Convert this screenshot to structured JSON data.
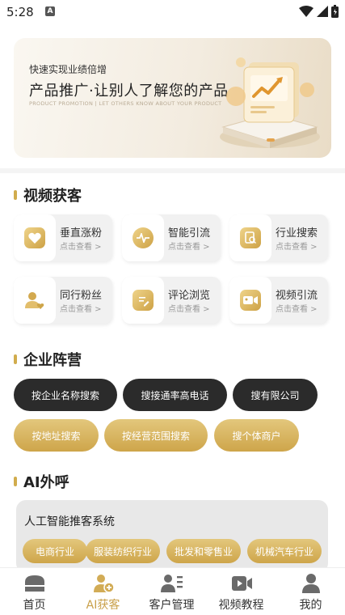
{
  "status_bar": {
    "time": "5:28",
    "notification_icon": "A"
  },
  "banner": {
    "small_text": "快速实现业绩倍增",
    "title": "产品推广·让别人了解您的产品",
    "english": "PRODUCT PROMOTION | LET OTHERS KNOW ABOUT YOUR PRODUCT"
  },
  "video_section": {
    "title": "视频获客",
    "cards": [
      {
        "title": "垂直涨粉",
        "sub": "点击查看 >",
        "icon": "heart-icon"
      },
      {
        "title": "智能引流",
        "sub": "点击查看 >",
        "icon": "pulse-icon"
      },
      {
        "title": "行业搜索",
        "sub": "点击查看 >",
        "icon": "document-search-icon"
      },
      {
        "title": "同行粉丝",
        "sub": "点击查看 >",
        "icon": "user-heart-icon"
      },
      {
        "title": "评论浏览",
        "sub": "点击查看 >",
        "icon": "edit-note-icon"
      },
      {
        "title": "视频引流",
        "sub": "点击查看 >",
        "icon": "video-camera-icon"
      }
    ]
  },
  "enterprise_section": {
    "title": "企业阵营",
    "buttons_dark": [
      "按企业名称搜索",
      "搜接通率高电话",
      "搜有限公司"
    ],
    "buttons_gold": [
      "按地址搜索",
      "按经营范围搜索",
      "搜个体商户"
    ]
  },
  "ai_section": {
    "title": "AI外呼",
    "panel_title": "人工智能推客系统",
    "tags": [
      "电商行业",
      "服装纺织行业",
      "批发和零售业",
      "机械汽车行业"
    ]
  },
  "bottom_nav": {
    "items": [
      {
        "label": "首页",
        "icon": "home-icon"
      },
      {
        "label": "AI获客",
        "icon": "add-user-icon"
      },
      {
        "label": "客户管理",
        "icon": "customer-list-icon"
      },
      {
        "label": "视频教程",
        "icon": "video-icon"
      },
      {
        "label": "我的",
        "icon": "profile-icon"
      }
    ],
    "active_index": 1
  },
  "colors": {
    "gold": "#cea54a",
    "dark": "#2b2b2b",
    "active_nav": "#c9a04a"
  }
}
